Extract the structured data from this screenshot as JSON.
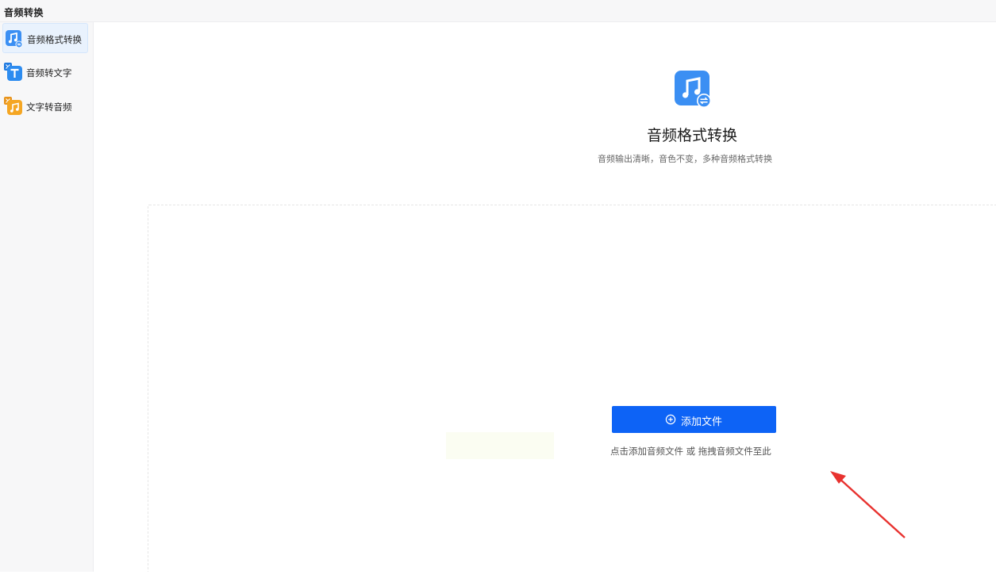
{
  "app": {
    "title": "音频转换"
  },
  "sidebar": {
    "items": [
      {
        "label": "音频格式转换",
        "icon": "music-note-convert-icon",
        "active": true,
        "color": "#2d8cf0"
      },
      {
        "label": "音频转文字",
        "icon": "audio-to-text-icon",
        "active": false,
        "color": "#2d8cf0"
      },
      {
        "label": "文字转音频",
        "icon": "text-to-audio-icon",
        "active": false,
        "color": "#f5a623"
      }
    ]
  },
  "main": {
    "hero_icon": "music-note-convert-icon",
    "title": "音频格式转换",
    "subtitle": "音频输出清晰，音色不变，多种音频格式转换",
    "add_button_label": "添加文件",
    "add_button_icon": "plus-circle-icon",
    "hint": "点击添加音频文件 或 拖拽音频文件至此",
    "accent_color": "#0d63f6"
  },
  "annotation": {
    "icon": "red-arrow-icon",
    "color": "#e8322f"
  }
}
